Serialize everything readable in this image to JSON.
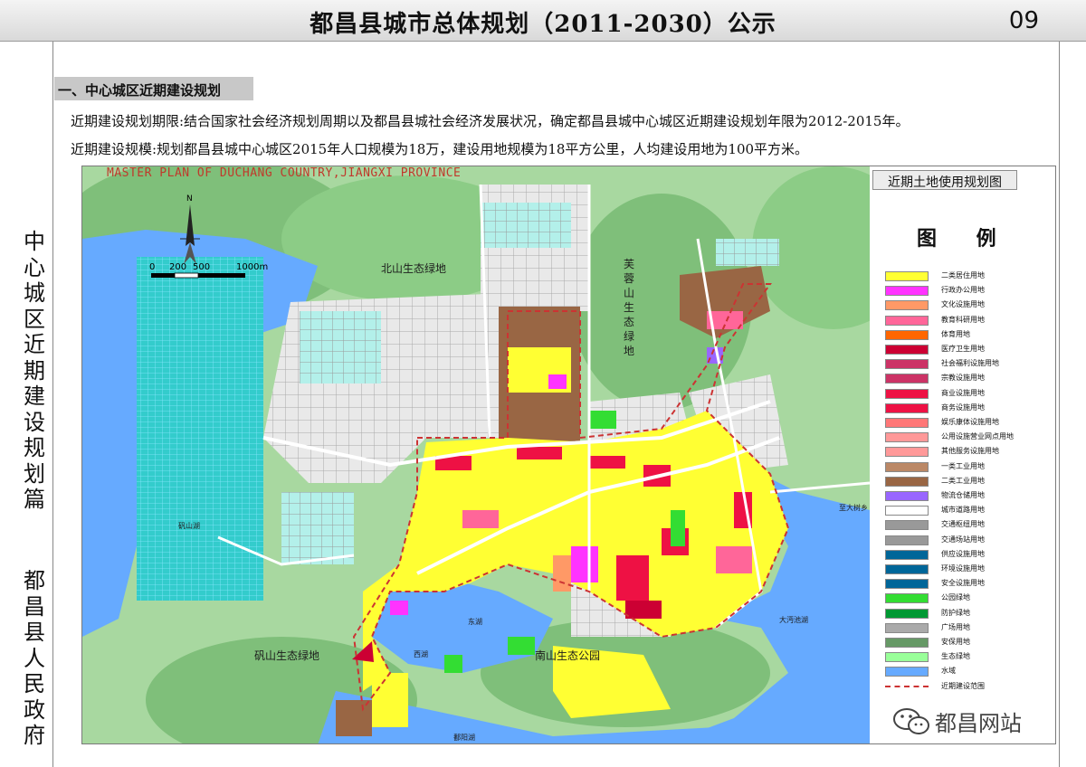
{
  "header": {
    "title": "都昌县城市总体规划（2011-2030）公示",
    "page_number": "09"
  },
  "sidebar": {
    "section_title": "中心城区近期建设规划篇",
    "author": "都昌县人民政府"
  },
  "section": {
    "heading": "一、中心城区近期建设规划",
    "intro_1": "近期建设规划期限:结合国家社会经济规划周期以及都昌县城社会经济发展状况，确定都昌县城中心城区近期建设规划年限为2012-2015年。",
    "intro_2": "近期建设规模:规划都昌县城中心城区2015年人口规模为18万，建设用地规模为18平方公里，人均建设用地为100平方米。"
  },
  "map": {
    "caption": "MASTER PLAN OF DUCHANG COUNTRY,JIANGXI PROVINCE",
    "panel_title": "近期土地使用规划图",
    "north_label": "N",
    "scale_labels": [
      "0",
      "200",
      "500",
      "1000m"
    ],
    "place_names": {
      "beishan": "北山生态绿地",
      "furongshan": "芙蓉山生态绿地",
      "fanshan": "矾山生态绿地",
      "nanshan": "南山生态公园",
      "donghu": "东湖",
      "xihu": "西湖",
      "dawuchi": "大沔池湖",
      "poyang": "鄱阳湖",
      "fanshanhu": "矾山湖",
      "road_east": "至大树乡"
    }
  },
  "legend": {
    "title": "图 例",
    "items": [
      {
        "label": "二类居住用地",
        "color": "#ffff33"
      },
      {
        "label": "行政办公用地",
        "color": "#ff33ff"
      },
      {
        "label": "文化设施用地",
        "color": "#ff9966"
      },
      {
        "label": "教育科研用地",
        "color": "#ff6699"
      },
      {
        "label": "体育用地",
        "color": "#ff6600"
      },
      {
        "label": "医疗卫生用地",
        "color": "#cc0033"
      },
      {
        "label": "社会福利设施用地",
        "color": "#cc3366"
      },
      {
        "label": "宗教设施用地",
        "color": "#cc3366"
      },
      {
        "label": "商业设施用地",
        "color": "#ee1144"
      },
      {
        "label": "商务设施用地",
        "color": "#ee1144"
      },
      {
        "label": "娱乐康体设施用地",
        "color": "#ff7777"
      },
      {
        "label": "公用设施营业网点用地",
        "color": "#ff9999"
      },
      {
        "label": "其他服务设施用地",
        "color": "#ff9999"
      },
      {
        "label": "一类工业用地",
        "color": "#bb8866"
      },
      {
        "label": "二类工业用地",
        "color": "#996644"
      },
      {
        "label": "物流仓储用地",
        "color": "#9966ff"
      },
      {
        "label": "城市道路用地",
        "color": "#ffffff"
      },
      {
        "label": "交通枢纽用地",
        "color": "#999999"
      },
      {
        "label": "交通场站用地",
        "color": "#999999"
      },
      {
        "label": "供应设施用地",
        "color": "#006699"
      },
      {
        "label": "环境设施用地",
        "color": "#006699"
      },
      {
        "label": "安全设施用地",
        "color": "#006699"
      },
      {
        "label": "公园绿地",
        "color": "#33dd33"
      },
      {
        "label": "防护绿地",
        "color": "#009933"
      },
      {
        "label": "广场用地",
        "color": "#aaaaaa"
      },
      {
        "label": "安保用地",
        "color": "#669966"
      },
      {
        "label": "生态绿地",
        "color": "#99ff99"
      },
      {
        "label": "水域",
        "color": "#66aaff"
      },
      {
        "label": "近期建设范围",
        "color": "#cc3333"
      }
    ]
  },
  "watermark": {
    "text": "都昌网站",
    "icon": "wechat-icon"
  }
}
